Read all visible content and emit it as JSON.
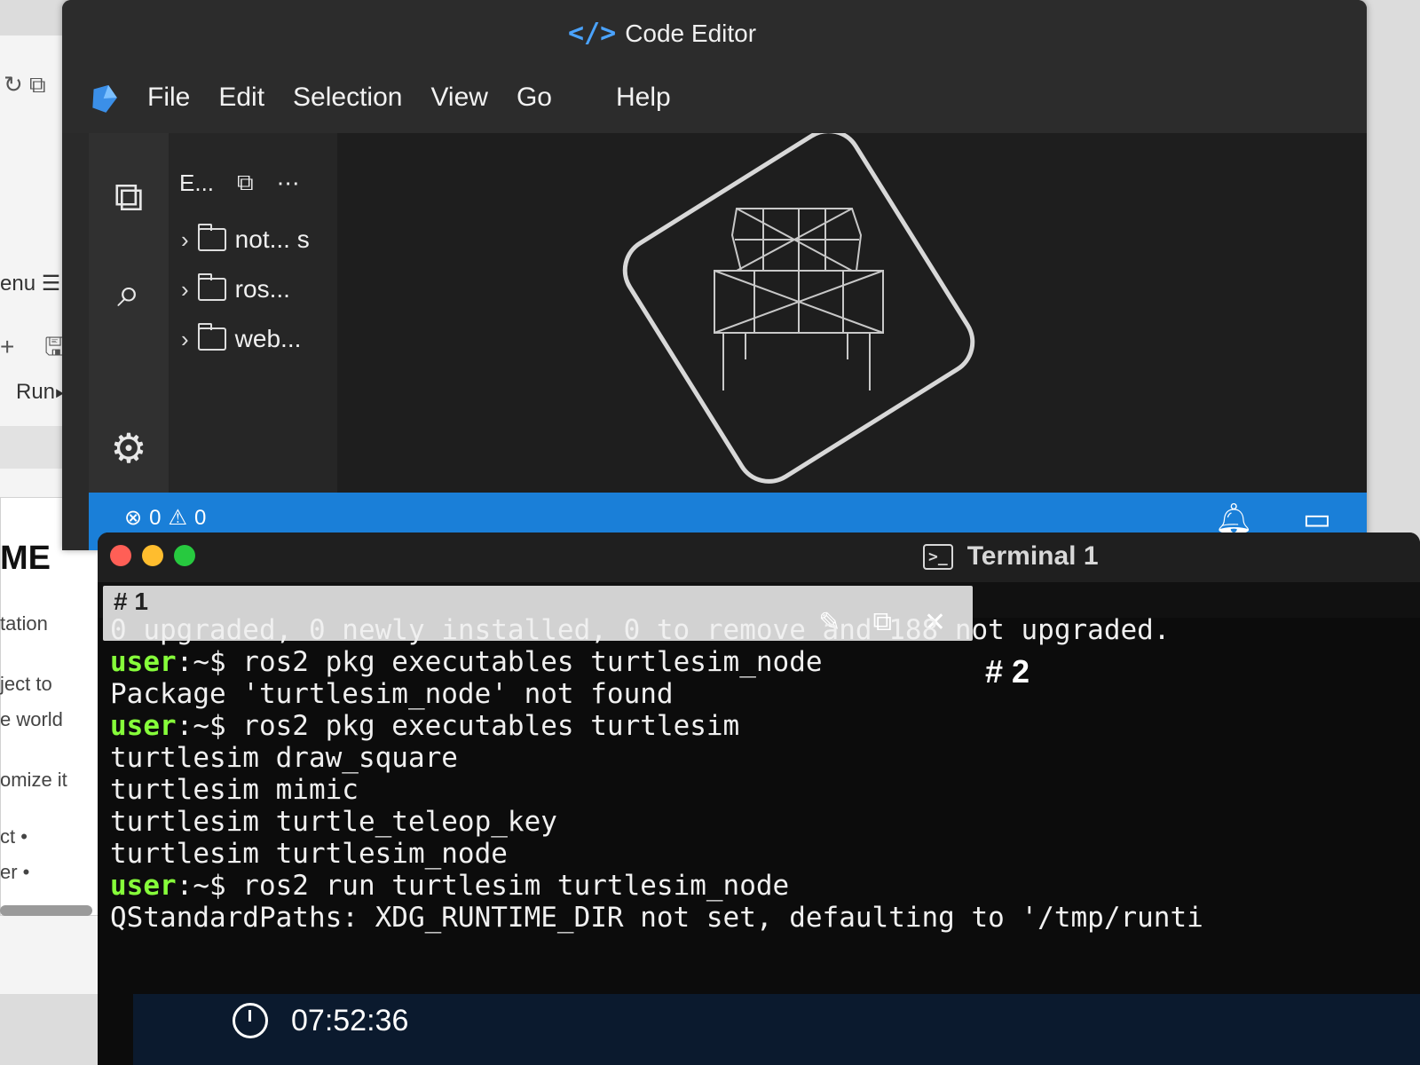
{
  "left_panel": {
    "menu_label": "enu ☰",
    "run_label": "Run⏭",
    "heading": "ME",
    "lines": [
      "tation",
      "ject to",
      "e world",
      "omize it",
      "ct •",
      "er •"
    ]
  },
  "editor": {
    "title": "Code Editor",
    "menu": [
      "File",
      "Edit",
      "Selection",
      "View",
      "Go",
      "Help"
    ],
    "explorer": {
      "header": "E...",
      "items": [
        {
          "label": "not... s"
        },
        {
          "label": "ros..."
        },
        {
          "label": "web..."
        }
      ]
    },
    "status": {
      "errors": "0",
      "warnings": "0"
    },
    "accent": "#1a7fd8"
  },
  "terminal": {
    "title": "Terminal 1",
    "tab1": "# 1",
    "tab2": "# 2",
    "prompt": "user",
    "lines": [
      {
        "type": "out",
        "text": "0 upgraded, 0 newly installed, 0 to remove and 188 not upgraded."
      },
      {
        "type": "cmd",
        "text": ":~$ ros2 pkg executables turtlesim_node"
      },
      {
        "type": "out",
        "text": "Package 'turtlesim_node' not found"
      },
      {
        "type": "cmd",
        "text": ":~$ ros2 pkg executables turtlesim"
      },
      {
        "type": "out",
        "text": "turtlesim draw_square"
      },
      {
        "type": "out",
        "text": "turtlesim mimic"
      },
      {
        "type": "out",
        "text": "turtlesim turtle_teleop_key"
      },
      {
        "type": "out",
        "text": "turtlesim turtlesim_node"
      },
      {
        "type": "cmd",
        "text": ":~$ ros2 run turtlesim turtlesim_node"
      },
      {
        "type": "out",
        "text": "QStandardPaths: XDG_RUNTIME_DIR not set, defaulting to '/tmp/runti"
      }
    ],
    "prompt_color": "#86ff3a"
  },
  "taskbar": {
    "time": "07:52:36"
  }
}
